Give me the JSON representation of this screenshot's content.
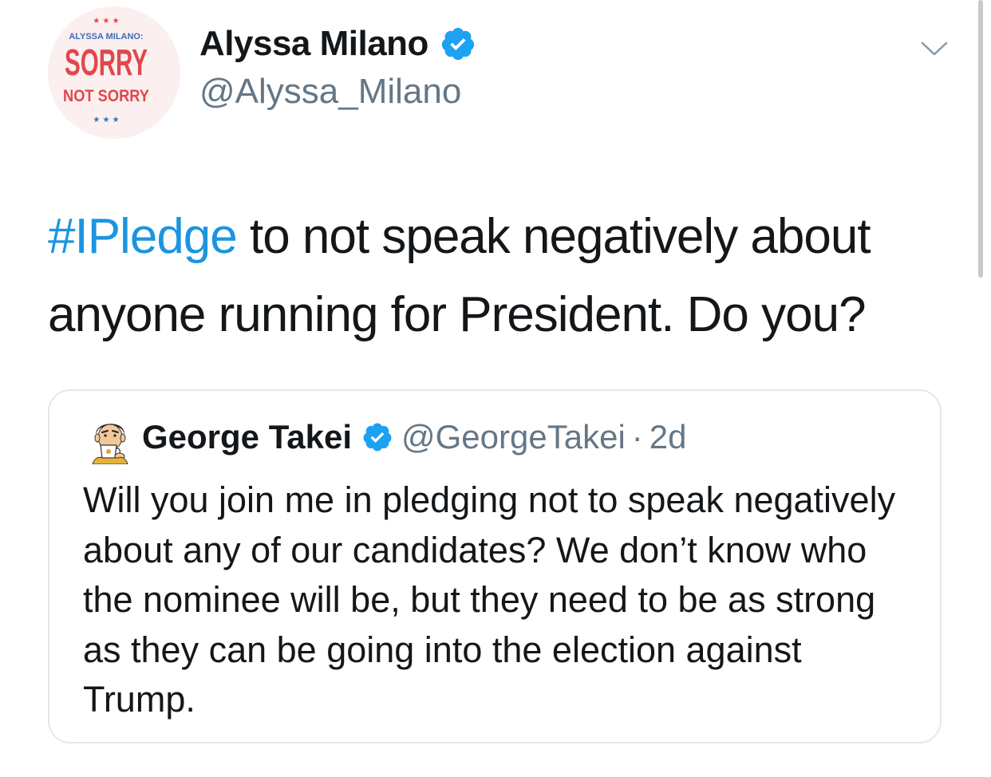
{
  "author": {
    "avatar_alt": "ALYSSA MILANO: SORRY NOT SORRY",
    "avatar_lines": {
      "top": "ALYSSA MILANO:",
      "big": "SORRY",
      "sub": "NOT SORRY"
    },
    "display_name": "Alyssa Milano",
    "handle": "@Alyssa_Milano",
    "verified_icon": "verified-badge-icon"
  },
  "menu_icon": "chevron-down-icon",
  "tweet": {
    "hashtag": "#IPledge",
    "text": " to not speak negatively about anyone running for President. Do you?"
  },
  "quoted_tweet": {
    "author_name": "George Takei",
    "author_handle": "@GeorgeTakei",
    "separator": "·",
    "time": "2d",
    "text": "Will you join me in pledging not to speak negatively about any of our candidates? We don’t know who the nominee will be, but they need to be as strong as they can be going into the election against Trump."
  },
  "colors": {
    "link": "#1b95e0",
    "verified": "#1da1f2",
    "text": "#14171a",
    "secondary": "#657786",
    "border": "#e1e8ed",
    "logo_red": "#e0474c",
    "logo_blue": "#3a6fb0"
  }
}
